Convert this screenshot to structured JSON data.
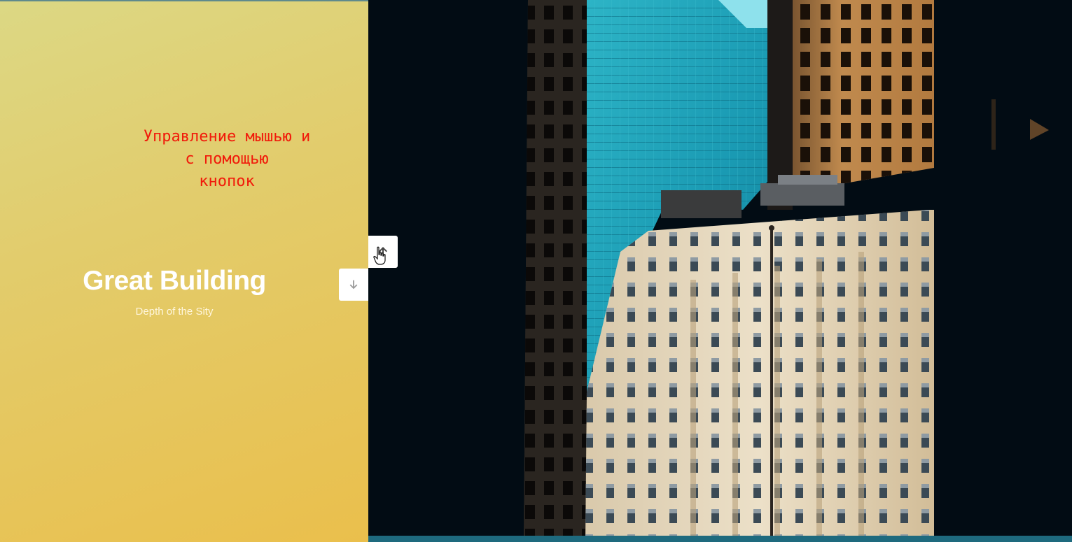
{
  "slide": {
    "caption": "Управление мышью и\nс помощью\nкнопок",
    "title": "Great Building",
    "subtitle": "Depth of the Sity"
  },
  "controls": {
    "up_icon": "arrow-up-icon",
    "down_icon": "arrow-down-icon"
  },
  "colors": {
    "left_gradient_start": "#dcd884",
    "left_gradient_end": "#eabf4c",
    "caption": "#f11a0a",
    "glass": "#1fa6bc",
    "sandstone": "#e6d7bc",
    "dark_bg": "#020c14"
  }
}
